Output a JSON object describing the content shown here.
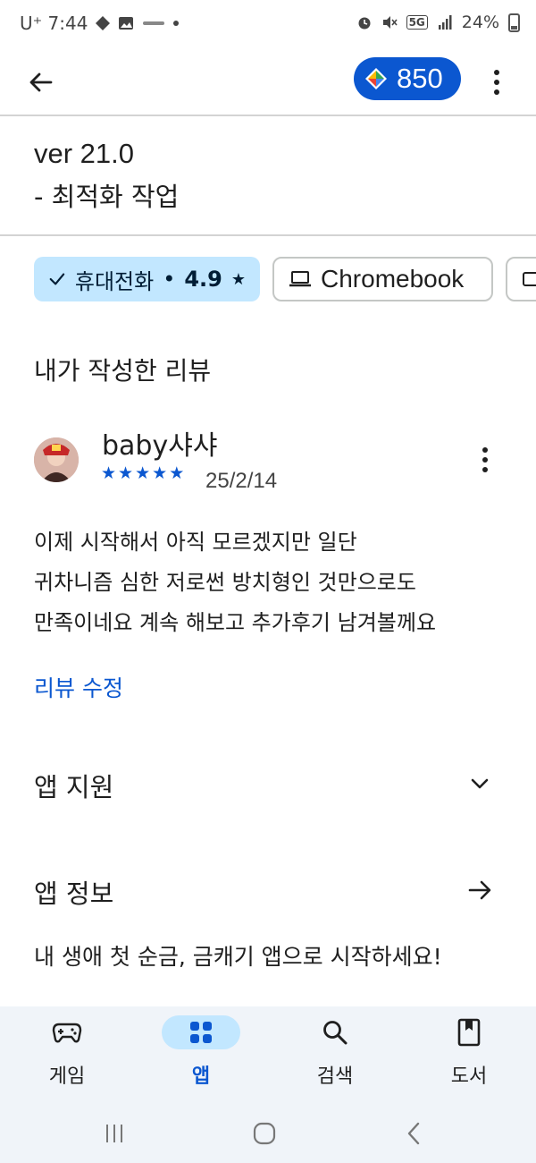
{
  "status_bar": {
    "carrier_time": "U⁺ 7:44",
    "network": "5G",
    "battery": "24%"
  },
  "app_bar": {
    "points_value": "850"
  },
  "whats_new": {
    "lines": [
      "ver 21.0",
      "- 최적화 작업"
    ]
  },
  "device_chips": [
    {
      "label": "휴대전화",
      "rating": "4.9",
      "selected": true,
      "icon": "check-icon"
    },
    {
      "label": "Chromebook",
      "selected": false,
      "icon": "laptop-icon"
    }
  ],
  "my_review": {
    "section_title": "내가 작성한 리뷰",
    "reviewer_name": "baby샤샤",
    "stars": 5,
    "date": "25/2/14",
    "text_lines": [
      "이제 시작해서 아직 모르겠지만 일단",
      "귀차니즘 심한 저로썬 방치형인 것만으로도",
      "만족이네요 계속 해보고 추가후기 남겨볼께요"
    ],
    "edit_label": "리뷰 수정"
  },
  "app_support": {
    "title": "앱 지원",
    "icon": "chevron-down-icon"
  },
  "app_info": {
    "title": "앱 정보",
    "icon": "arrow-right-icon",
    "description": "내 생애 첫 순금, 금캐기 앱으로 시작하세요!"
  },
  "bottom_nav": {
    "items": [
      {
        "label": "게임",
        "icon": "gamepad-icon",
        "active": false
      },
      {
        "label": "앱",
        "icon": "apps-grid-icon",
        "active": true
      },
      {
        "label": "검색",
        "icon": "search-icon",
        "active": false
      },
      {
        "label": "도서",
        "icon": "bookmark-icon",
        "active": false
      }
    ]
  },
  "colors": {
    "accent": "#0b57d0",
    "chip_selected_bg": "#c2e7ff",
    "nav_bg": "#f0f4f9"
  }
}
